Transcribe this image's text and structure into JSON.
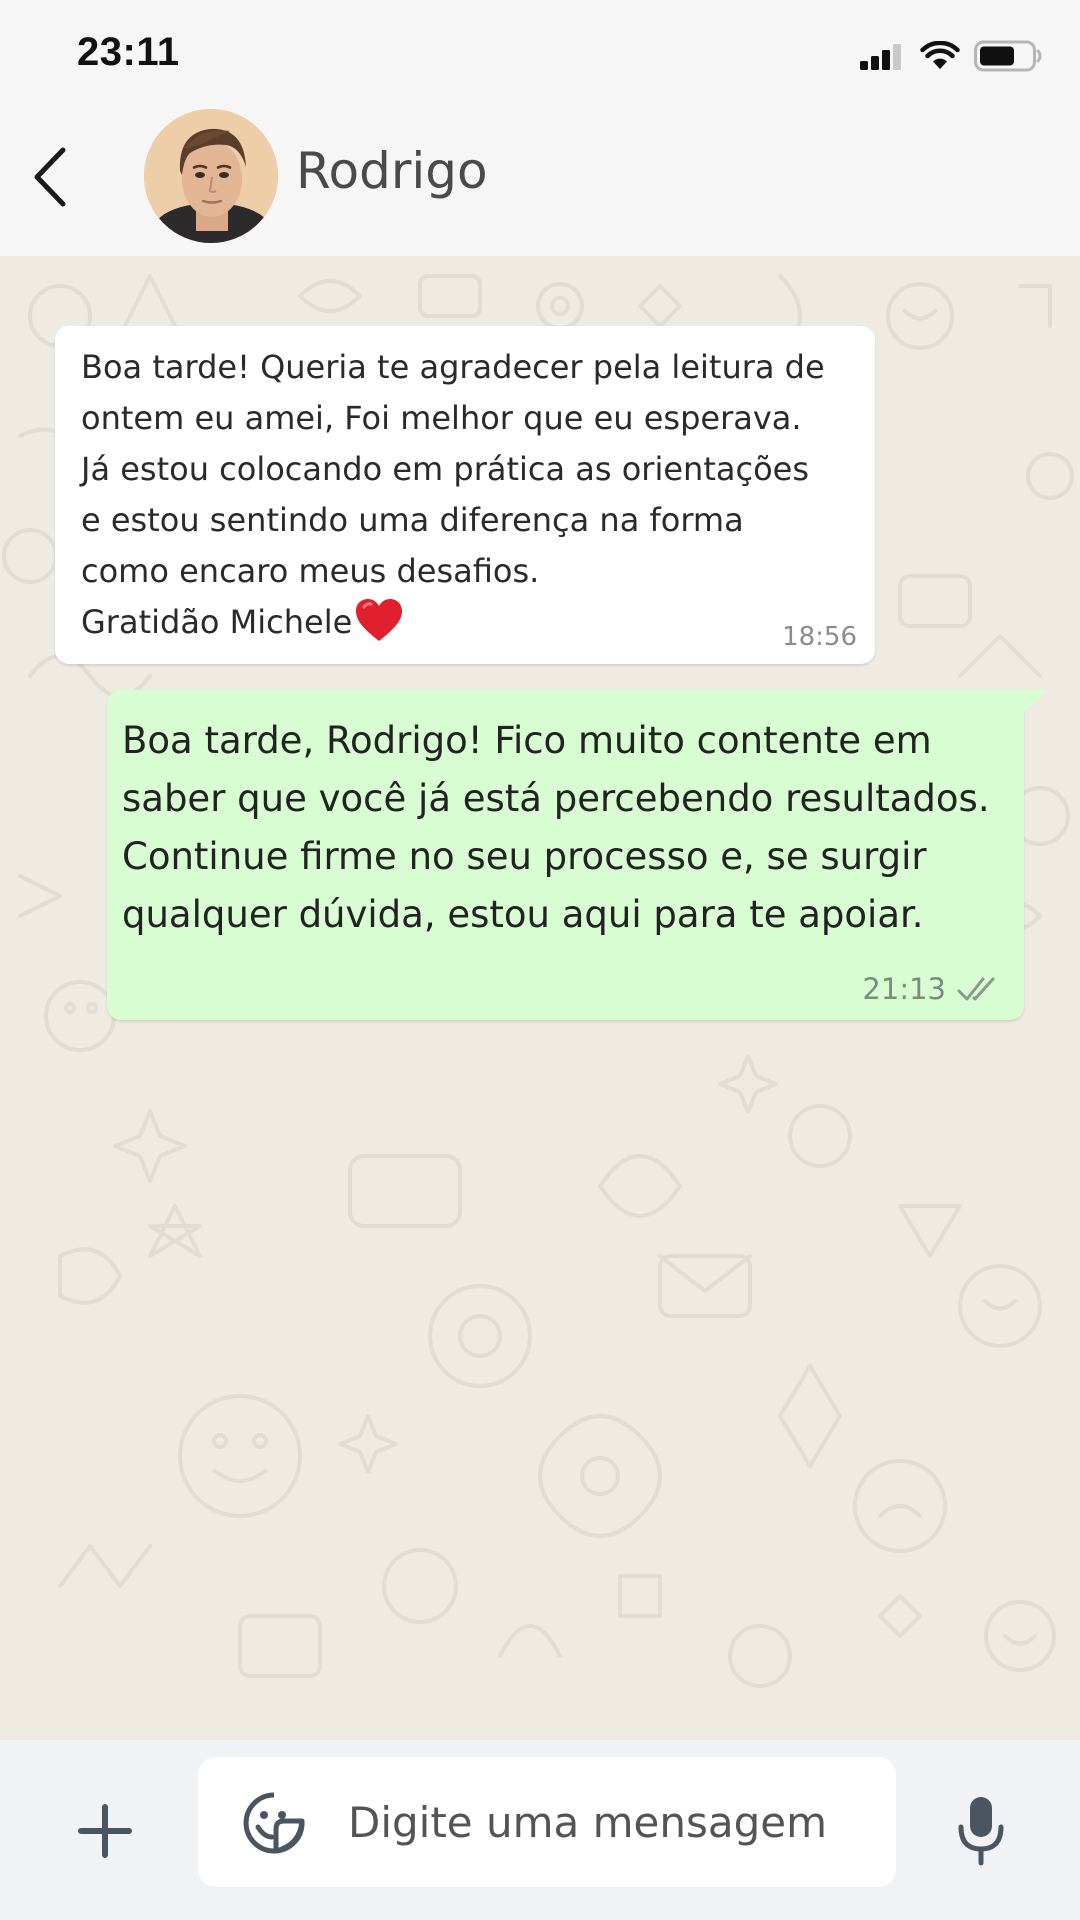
{
  "status_bar": {
    "time": "23:11",
    "icons": [
      "signal-icon",
      "wifi-icon",
      "battery-icon"
    ]
  },
  "header": {
    "contact_name": "Rodrigo",
    "back_icon": "chevron-left-icon",
    "avatar": "contact-avatar-photo"
  },
  "messages": [
    {
      "direction": "incoming",
      "text": "Boa tarde! Queria te agradecer pela leitura de\nontem eu amei, Foi melhor que eu esperava.\nJá estou colocando em prática as orientações\ne estou sentindo uma diferença na forma\ncomo encaro meus desafios.\nGratidão Michele",
      "emoji": "❤️",
      "time": "18:56"
    },
    {
      "direction": "outgoing",
      "text": "Boa tarde, Rodrigo! Fico muito contente em\nsaber que você já está percebendo resultados.\nContinue firme no seu processo e, se surgir\nqualquer dúvida, estou aqui para te apoiar.",
      "time": "21:13",
      "status": "read"
    }
  ],
  "input_bar": {
    "placeholder": "Digite uma mensagem",
    "attach_icon": "plus-icon",
    "sticker_icon": "sticker-icon",
    "mic_icon": "microphone-icon"
  },
  "colors": {
    "chat_background": "#efeae2",
    "incoming_bubble": "#ffffff",
    "outgoing_bubble": "#d9fdd3",
    "bar_background": "#f6f6f6",
    "input_bar_background": "#f0f2f5"
  }
}
